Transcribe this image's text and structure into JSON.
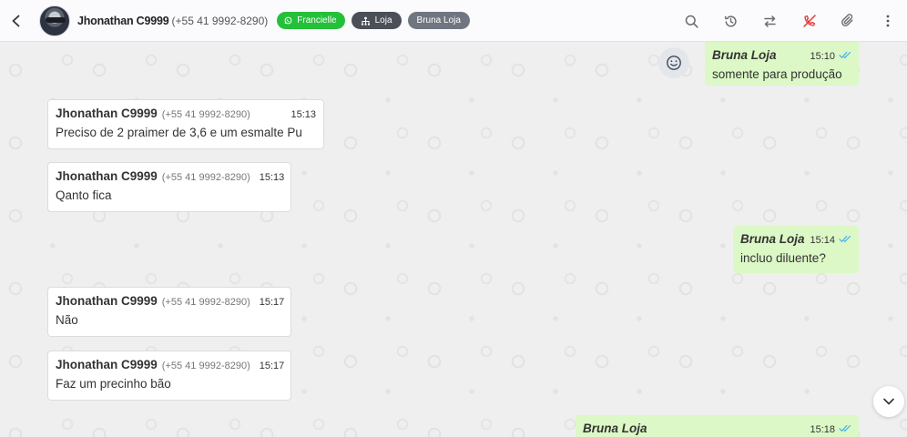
{
  "header": {
    "contact_name": "Jhonathan C9999",
    "contact_phone": "(+55 41 9992-8290)",
    "tags": [
      {
        "label": "Francielle",
        "icon": "whatsapp-icon",
        "color": "#25c03a"
      },
      {
        "label": "Loja",
        "icon": "sitemap-icon",
        "color": "#4a4f58"
      },
      {
        "label": "Bruna Loja",
        "icon": "",
        "color": "#6f7680"
      }
    ],
    "actions": [
      "search-icon",
      "history-icon",
      "transfer-icon",
      "end-call-icon",
      "attach-icon",
      "more-vertical-icon"
    ]
  },
  "messages": [
    {
      "direction": "out",
      "sender": "Bruna Loja",
      "time": "15:10",
      "text": "somente para produção"
    },
    {
      "direction": "in",
      "sender": "Jhonathan C9999",
      "phone": "(+55 41 9992-8290)",
      "time": "15:13",
      "text": "Preciso de 2 praimer de 3,6 e um esmalte Pu"
    },
    {
      "direction": "in",
      "sender": "Jhonathan C9999",
      "phone": "(+55 41 9992-8290)",
      "time": "15:13",
      "text": "Qanto fica"
    },
    {
      "direction": "out",
      "sender": "Bruna Loja",
      "time": "15:14",
      "text": "incluo diluente?"
    },
    {
      "direction": "in",
      "sender": "Jhonathan C9999",
      "phone": "(+55 41 9992-8290)",
      "time": "15:17",
      "text": "Não"
    },
    {
      "direction": "in",
      "sender": "Jhonathan C9999",
      "phone": "(+55 41 9992-8290)",
      "time": "15:17",
      "text": "Faz um precinho bão"
    },
    {
      "direction": "out",
      "sender": "Bruna Loja",
      "time": "15:18",
      "text": ""
    }
  ],
  "colors": {
    "outgoing_bubble": "#dcf8c6",
    "incoming_bubble": "#ffffff",
    "ticks": "#4fb6ec",
    "end_call": "#e53935"
  }
}
